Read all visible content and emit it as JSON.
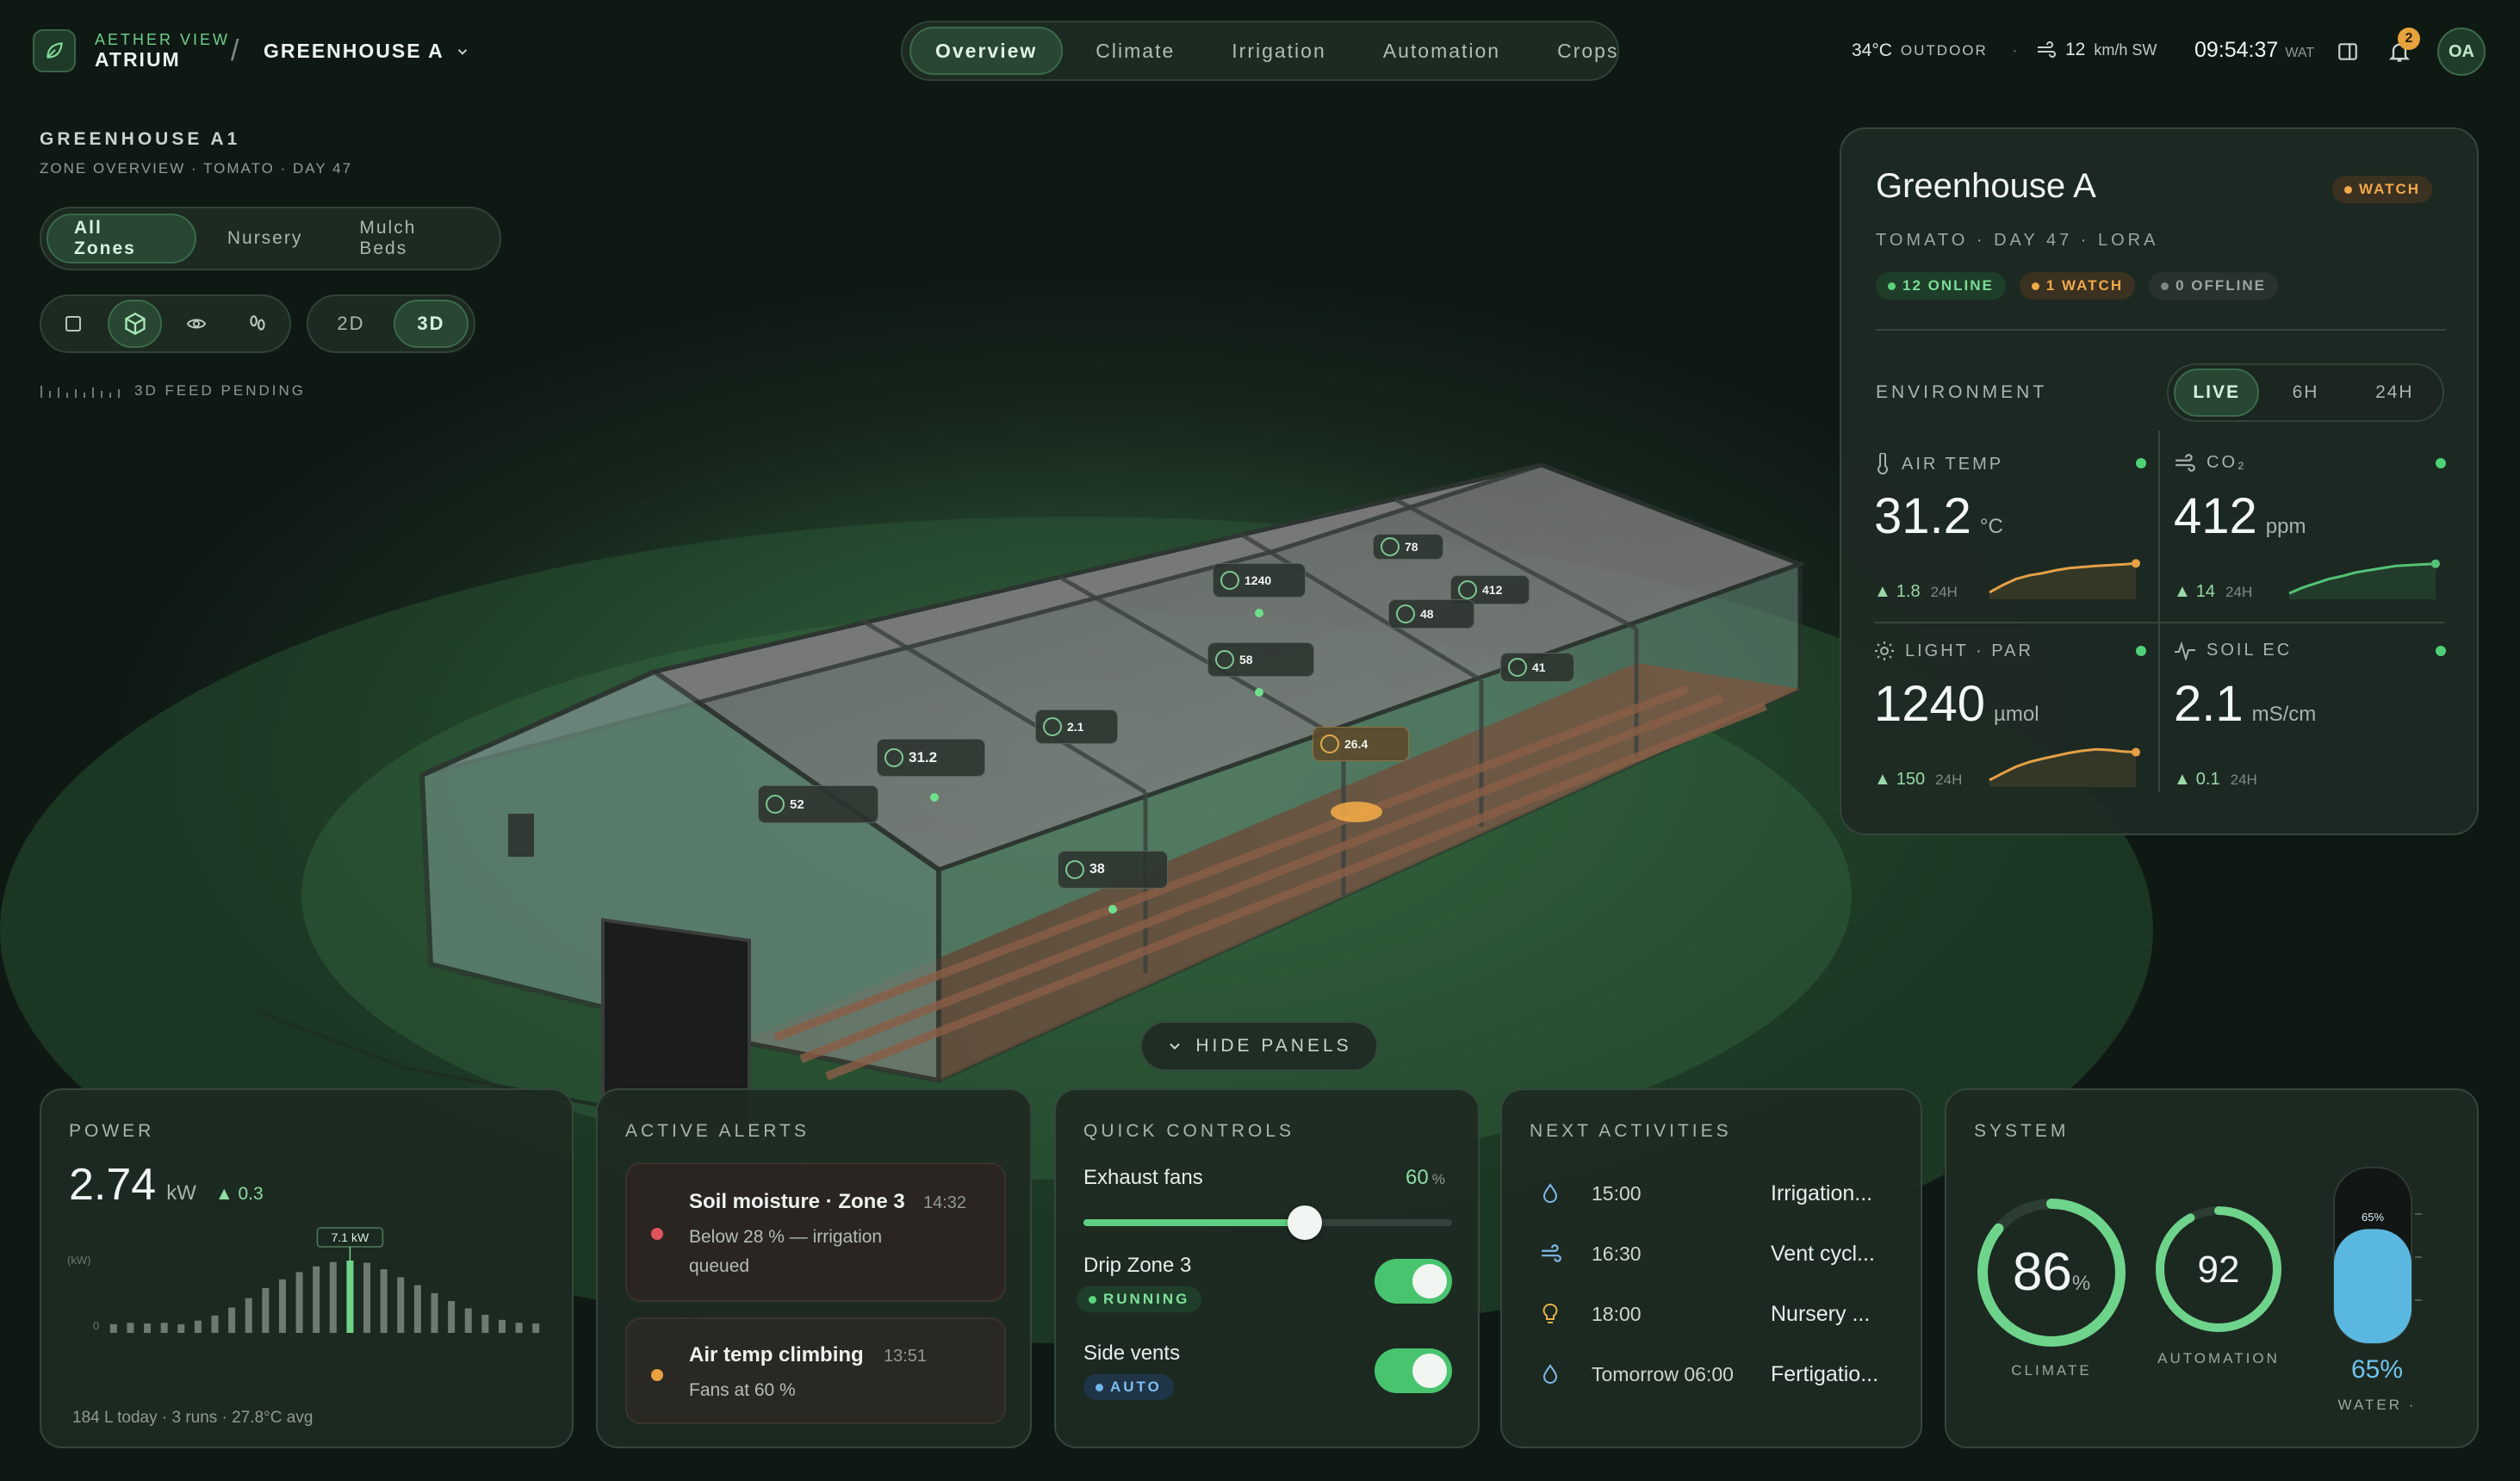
{
  "brand": {
    "small": "AETHER VIEW",
    "name": "ATRIUM"
  },
  "breadcrumb": {
    "greenhouse": "GREENHOUSE A"
  },
  "nav_tabs": [
    "Overview",
    "Climate",
    "Irrigation",
    "Automation",
    "Crops"
  ],
  "topbar": {
    "temp": "34°C",
    "temp_label": "OUTDOOR",
    "wind": "12",
    "wind_unit": "km/h SW",
    "time": "09:54:37",
    "tz": "WAT",
    "notifications": "2",
    "avatar": "OA"
  },
  "zone": {
    "title": "GREENHOUSE A1",
    "subtitle": "ZONE OVERVIEW · TOMATO · DAY 47",
    "tabs": [
      "All Zones",
      "Nursery",
      "Mulch Beds"
    ],
    "view_modes": [
      "2D",
      "3D"
    ],
    "feed": "3D FEED PENDING"
  },
  "sensor_tags": [
    "78",
    "1240",
    "412",
    "48",
    "58",
    "41",
    "2.1",
    "31.2",
    "26.4",
    "52",
    "38"
  ],
  "panel": {
    "title": "Greenhouse A",
    "status": "WATCH",
    "subtitle": "TOMATO · DAY 47 · LORA",
    "pills": [
      "12 ONLINE",
      "1 WATCH",
      "0 OFFLINE"
    ],
    "env_label": "ENVIRONMENT",
    "ranges": [
      "LIVE",
      "6H",
      "24H"
    ],
    "metrics": [
      {
        "label": "AIR TEMP",
        "value": "31.2",
        "unit": "°C",
        "delta": "1.8",
        "period": "24H",
        "color": "#e6a046",
        "trend": [
          0.05,
          0.25,
          0.42,
          0.52,
          0.58,
          0.66,
          0.72,
          0.75,
          0.78,
          0.8,
          0.82,
          0.85
        ]
      },
      {
        "label": "CO₂",
        "value": "412",
        "unit": "ppm",
        "delta": "14",
        "period": "24H",
        "color": "#54c276",
        "trend": [
          0.02,
          0.18,
          0.3,
          0.42,
          0.5,
          0.6,
          0.66,
          0.72,
          0.78,
          0.8,
          0.82,
          0.84
        ]
      },
      {
        "label": "LIGHT · PAR",
        "value": "1240",
        "unit": "µmol",
        "delta": "150",
        "period": "24H",
        "color": "#e6a046",
        "trend": [
          0.05,
          0.24,
          0.42,
          0.55,
          0.64,
          0.72,
          0.8,
          0.86,
          0.9,
          0.88,
          0.84,
          0.82
        ]
      },
      {
        "label": "SOIL EC",
        "value": "2.1",
        "unit": "mS/cm",
        "delta": "0.1",
        "period": "24H",
        "color": "#54c276",
        "trend": []
      }
    ]
  },
  "hide_panels": "HIDE PANELS",
  "power": {
    "title": "POWER",
    "value": "2.74",
    "unit": "kW",
    "delta": "0.3",
    "peak": "7.1 kW",
    "axis_label": "(kW)",
    "axis_zero": "0",
    "footer": "184 L today · 3 runs · 27.8°C avg",
    "bars": [
      0.12,
      0.14,
      0.13,
      0.14,
      0.12,
      0.17,
      0.24,
      0.35,
      0.48,
      0.62,
      0.74,
      0.84,
      0.92,
      0.98,
      1.0,
      0.97,
      0.88,
      0.77,
      0.66,
      0.55,
      0.44,
      0.34,
      0.25,
      0.18,
      0.14,
      0.13
    ],
    "peak_index": 14
  },
  "alerts": {
    "title": "ACTIVE ALERTS",
    "items": [
      {
        "title": "Soil moisture · Zone 3",
        "time": "14:32",
        "desc1": "Below 28 % — irrigation",
        "desc2": "queued",
        "color": "#e0545c"
      },
      {
        "title": "Air temp climbing",
        "time": "13:51",
        "desc1": "Fans at 60 %",
        "desc2": "",
        "color": "#e8a040"
      }
    ]
  },
  "controls": {
    "title": "QUICK CONTROLS",
    "fans_label": "Exhaust fans",
    "fans_value": "60",
    "fans_unit": "%",
    "fans_level": 0.6,
    "drip_label": "Drip Zone 3",
    "drip_status": "RUNNING",
    "vents_label": "Side vents",
    "vents_status": "AUTO"
  },
  "activities": {
    "title": "NEXT ACTIVITIES",
    "items": [
      {
        "time": "15:00",
        "name": "Irrigation...",
        "icon": "droplet-icon"
      },
      {
        "time": "16:30",
        "name": "Vent cycl...",
        "icon": "wind-icon"
      },
      {
        "time": "18:00",
        "name": "Nursery ...",
        "icon": "bulb-icon"
      },
      {
        "time": "Tomorrow 06:00",
        "name": "Fertigatio...",
        "icon": "droplet-icon"
      }
    ]
  },
  "system": {
    "title": "SYSTEM",
    "climate": "86",
    "climate_unit": "%",
    "climate_label": "CLIMATE",
    "climate_level": 0.86,
    "automation": "92",
    "automation_label": "AUTOMATION",
    "automation_level": 0.92,
    "water": "65%",
    "water_label": "WATER ·",
    "water_level": 0.65,
    "water_tank_label": "65%"
  }
}
